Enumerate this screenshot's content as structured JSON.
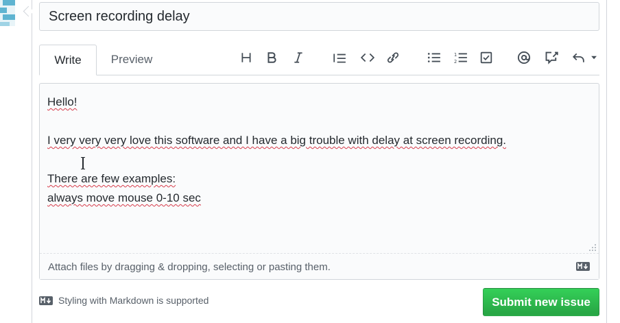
{
  "issue": {
    "title_value": "Screen recording delay"
  },
  "tabs": [
    {
      "label": "Write",
      "selected": true
    },
    {
      "label": "Preview",
      "selected": false
    }
  ],
  "toolbar": {
    "icons": [
      "header-icon",
      "bold-icon",
      "italic-icon",
      "quote-icon",
      "code-icon",
      "link-icon",
      "bulleted-list-icon",
      "numbered-list-icon",
      "task-list-icon",
      "mention-icon",
      "cross-reference-icon",
      "saved-replies-icon"
    ]
  },
  "editor": {
    "lines": [
      "Hello!",
      "",
      "I very very very love this software and I have a big trouble with delay at screen recording.",
      "",
      "There are few examples:",
      "always move mouse 0-10 sec"
    ]
  },
  "attach": {
    "text": "Attach files by dragging & dropping, selecting or pasting them."
  },
  "footer": {
    "markdown_note": "Styling with Markdown is supported",
    "submit_label": "Submit new issue"
  },
  "colors": {
    "accent_green": "#28a745",
    "border": "#d1d5da",
    "text": "#24292e",
    "muted": "#586069"
  }
}
